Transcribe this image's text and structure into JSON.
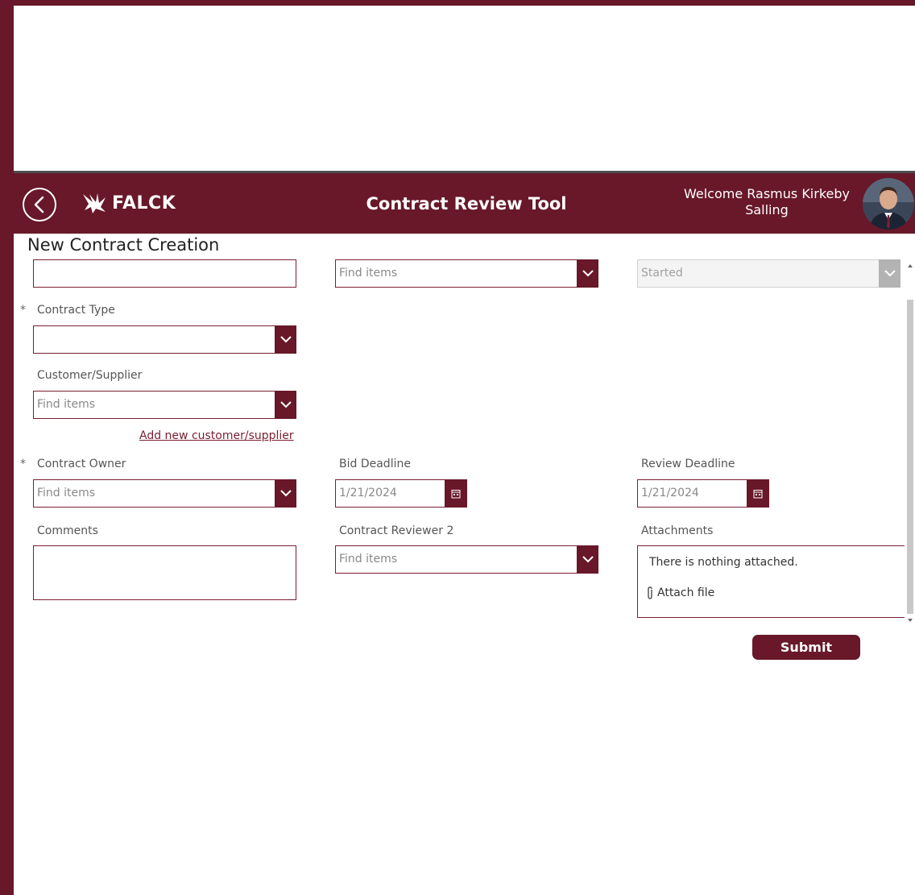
{
  "header": {
    "logo_text": "FALCK",
    "app_title": "Contract Review Tool",
    "welcome": "Welcome Rasmus Kirkeby Salling"
  },
  "page": {
    "title": "New Contract Creation"
  },
  "form": {
    "status": {
      "value": "Started"
    },
    "top_lookup": {
      "placeholder": "Find items"
    },
    "contract_type": {
      "label": "Contract Type",
      "value": ""
    },
    "customer_supplier": {
      "label": "Customer/Supplier",
      "placeholder": "Find items"
    },
    "add_customer_link": "Add new customer/supplier",
    "contract_owner": {
      "label": "Contract Owner",
      "placeholder": "Find items"
    },
    "bid_deadline": {
      "label": "Bid Deadline",
      "value": "1/21/2024"
    },
    "review_deadline": {
      "label": "Review Deadline",
      "value": "1/21/2024"
    },
    "comments": {
      "label": "Comments"
    },
    "contract_reviewer_2": {
      "label": "Contract Reviewer 2",
      "placeholder": "Find items"
    },
    "attachments": {
      "label": "Attachments",
      "empty_text": "There is nothing attached.",
      "attach_label": "Attach file"
    },
    "required_marker": "*",
    "submit_label": "Submit"
  },
  "colors": {
    "brand": "#681829",
    "border": "#7a1f32",
    "disabled": "#b3b3b3"
  },
  "icons": [
    "back-arrow-icon",
    "falck-logo-icon",
    "chevron-down-icon",
    "calendar-icon",
    "paperclip-icon"
  ]
}
